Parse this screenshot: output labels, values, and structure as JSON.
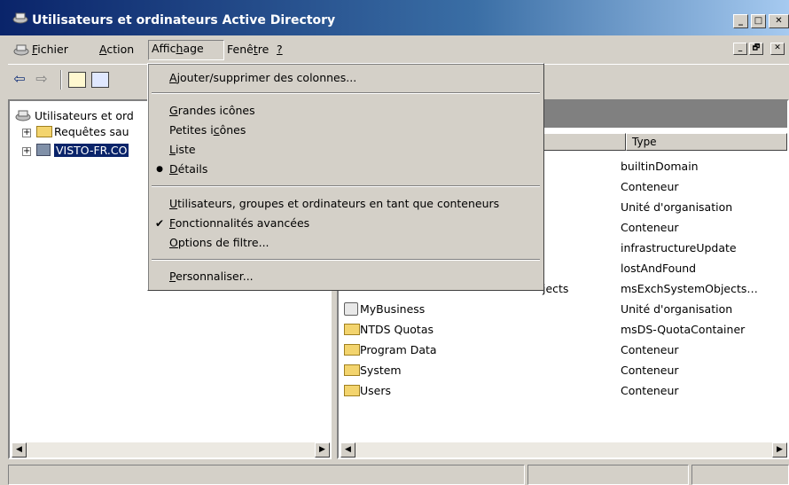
{
  "window": {
    "title": "Utilisateurs et ordinateurs Active Directory",
    "min": "_",
    "max": "□",
    "close": "✕"
  },
  "menubar": {
    "items": [
      {
        "pre": "",
        "u": "F",
        "post": "ichier"
      },
      {
        "pre": "",
        "u": "A",
        "post": "ction"
      },
      {
        "pre": "Affic",
        "u": "h",
        "post": "age"
      },
      {
        "pre": "Fenê",
        "u": "t",
        "post": "re"
      },
      {
        "pre": "",
        "u": "?",
        "post": ""
      }
    ],
    "mdi_min": "_",
    "mdi_restore": "🗗",
    "mdi_close": "✕"
  },
  "toolbar": {
    "back": "⇦",
    "forward": "⇨"
  },
  "tree": {
    "root": "Utilisateurs et ord",
    "child1": "Requêtes sau",
    "child2": "VISTO-FR.CO"
  },
  "list": {
    "col_type": "Type",
    "rows": [
      {
        "name": "",
        "type": "builtinDomain"
      },
      {
        "name": "",
        "type": "Conteneur"
      },
      {
        "name": "",
        "type": "Unité d'organisation"
      },
      {
        "name": "",
        "type": "Conteneur"
      },
      {
        "name": "",
        "type": "infrastructureUpdate"
      },
      {
        "name": "",
        "type": "lostAndFound"
      },
      {
        "name": "jects",
        "type": "msExchSystemObjects…"
      },
      {
        "name": "MyBusiness",
        "type": "Unité d'organisation"
      },
      {
        "name": "NTDS Quotas",
        "type": "msDS-QuotaContainer"
      },
      {
        "name": "Program Data",
        "type": "Conteneur"
      },
      {
        "name": "System",
        "type": "Conteneur"
      },
      {
        "name": "Users",
        "type": "Conteneur"
      }
    ]
  },
  "dropdown": {
    "add_columns": {
      "u": "A",
      "post": "jouter/supprimer des colonnes..."
    },
    "large_icons": {
      "u": "G",
      "post": "randes icônes"
    },
    "small_icons": {
      "pre": "Petites i",
      "u": "c",
      "post": "ônes"
    },
    "list": {
      "u": "L",
      "post": "iste"
    },
    "details": {
      "u": "D",
      "post": "étails"
    },
    "users_groups": {
      "u": "U",
      "post": "tilisateurs, groupes et ordinateurs en tant que conteneurs"
    },
    "advanced": {
      "u": "F",
      "post": "onctionnalités avancées"
    },
    "filter": {
      "u": "O",
      "post": "ptions de filtre..."
    },
    "customize": {
      "u": "P",
      "post": "ersonnaliser..."
    },
    "bullet": "●",
    "check": "✔"
  },
  "scroll": {
    "left": "◀",
    "right": "▶"
  }
}
